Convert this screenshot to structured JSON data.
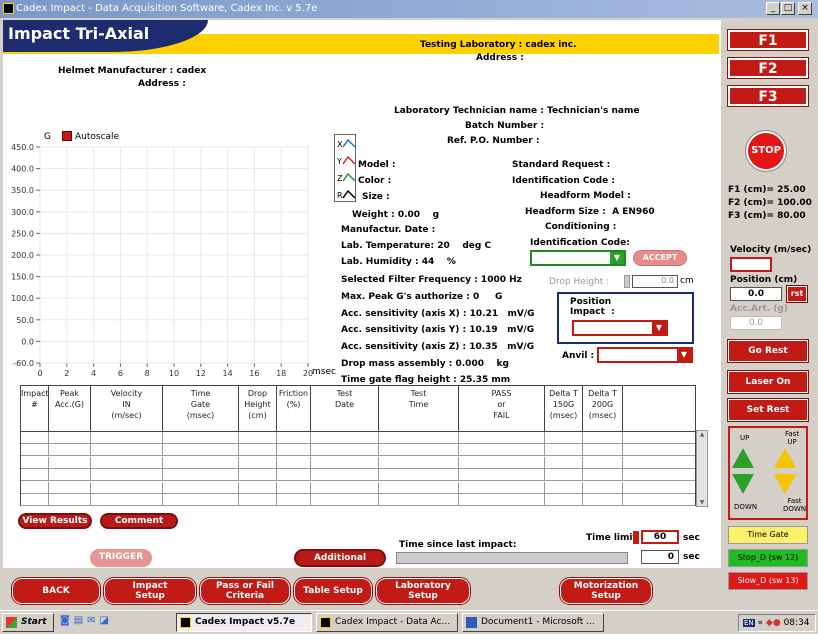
{
  "window": {
    "title": "Cadex Impact - Data Acquisition Software, Cadex Inc. v 5.7e",
    "min": "_",
    "max": "□",
    "close": "×"
  },
  "app": {
    "title": "Impact Tri-Axial"
  },
  "lab": {
    "testing_label": "Testing Laboratory :",
    "testing_value": "cadex inc.",
    "address_label": "Address :"
  },
  "helmet": {
    "manufacturer_label": "Helmet Manufacturer :",
    "manufacturer_value": "cadex",
    "address_label": "Address :"
  },
  "info": {
    "tech_label": "Laboratory Technician name :",
    "tech_value": "Technician's name",
    "batch_label": "Batch Number :",
    "po_label": "Ref. P.O. Number :",
    "model_label": "Model :",
    "color_label": "Color :",
    "size_label": "Size :",
    "weight_label": "Weight :",
    "weight_value": "0.00",
    "weight_unit": "g",
    "manuf_date_label": "Manufactur. Date :",
    "temp_label": "Lab. Temperature:",
    "temp_value": "20",
    "temp_unit": "deg C",
    "hum_label": "Lab. Humidity :",
    "hum_value": "44",
    "hum_unit": "%",
    "filter": "Selected Filter Frequency : 1000 Hz",
    "maxpeak_label": "Max. Peak G's authorize :",
    "maxpeak_value": "0",
    "maxpeak_unit": "G",
    "accx": "Acc. sensitivity (axis X) : 10.21",
    "accy": "Acc. sensitivity (axis Y) : 10.19",
    "accz": "Acc. sensitivity (axis Z) : 10.35",
    "acc_unit": "mV/G",
    "dropmass": "Drop mass assembly : 0.000",
    "dropmass_unit": "kg",
    "timegate": "Time gate flag height : 25.35 mm",
    "std_label": "Standard Request :",
    "ident_label": "Identification Code :",
    "headform_model_label": "Headform Model :",
    "headform_size_label": "Headform Size :",
    "headform_size_value": "A  EN960",
    "conditioning_label": "Conditioning :",
    "ident_code_label": "Identification Code:",
    "accept": "ACCEPT",
    "drop_height_label": "Drop Height :",
    "drop_height_value": "0.0",
    "drop_height_unit": "cm",
    "position_impact_label": "Position\nImpact  :",
    "anvil_label": "Anvil :"
  },
  "chart": {
    "autoscale": "Autoscale",
    "ylabel": "G",
    "xunit": "msec",
    "legend": [
      "X",
      "Y",
      "Z",
      "R"
    ]
  },
  "chart_data": {
    "type": "line",
    "xlim": [
      0,
      20
    ],
    "ylim": [
      -60,
      450
    ],
    "yticks": [
      "450.0",
      "400.0",
      "350.0",
      "300.0",
      "250.0",
      "200.0",
      "150.0",
      "100.0",
      "50.0",
      "0.0",
      "-60.0"
    ],
    "xticks": [
      "0",
      "2",
      "4",
      "6",
      "8",
      "10",
      "12",
      "14",
      "16",
      "18",
      "20"
    ],
    "series": [],
    "grid": true
  },
  "table": {
    "headers": [
      "Impact\n#",
      "Peak\nAcc.(G)",
      "Velocity\nIN\n(m/sec)",
      "Time\nGate\n(msec)",
      "Drop\nHeight\n(cm)",
      "Friction\n(%)",
      "Test\nDate",
      "Test\nTime",
      "PASS\nor\nFAIL",
      "Delta T\n150G\n(msec)",
      "Delta T\n200G\n(msec)",
      ""
    ]
  },
  "actions": {
    "view_results": "View Results",
    "comment": "Comment",
    "trigger": "TRIGGER",
    "additional": "Additional impact",
    "time_since": "Time since last impact:",
    "time_limit": "Time limit",
    "time_limit_value": "60",
    "sec": "sec",
    "elapsed": "0"
  },
  "bottom": [
    "BACK",
    "Impact\nSetup",
    "Pass or Fail\nCriteria",
    "Table Setup",
    "Laboratory\nSetup",
    "Motorization\nSetup"
  ],
  "side": {
    "f1": "F1",
    "f2": "F2",
    "f3": "F3",
    "stop": "STOP",
    "f1cm": "F1 (cm)=  25.00",
    "f2cm": "F2 (cm)=  100.00",
    "f3cm": "F3 (cm)=  80.00",
    "velocity_label": "Velocity (m/sec)",
    "position_label": "Position (cm)",
    "position_value": "0.0",
    "rst": "rst",
    "accart_label": "Acc.Art.  (g)",
    "accart_value": "0.0",
    "go_rest": "Go Rest",
    "laser_on": "Laser On",
    "set_rest": "Set Rest",
    "up": "UP",
    "fast_up": "Fast\nUP",
    "down": "DOWN",
    "fast_down": "Fast\nDOWN",
    "time_gate": "Time Gate",
    "stop_d": "Stop_D (sw 12)",
    "slow_d": "Slow_D (sw 13)"
  },
  "taskbar": {
    "start": "Start",
    "items": [
      "Cadex Impact v5.7e",
      "Cadex Impact - Data Ac...",
      "Document1 - Microsoft ..."
    ],
    "lang": "EN",
    "clock": "08:34"
  },
  "colors": {
    "accent": "#c21a14",
    "banner": "#ffd100",
    "navy": "#1c2c6e",
    "green": "#2aa12a"
  }
}
